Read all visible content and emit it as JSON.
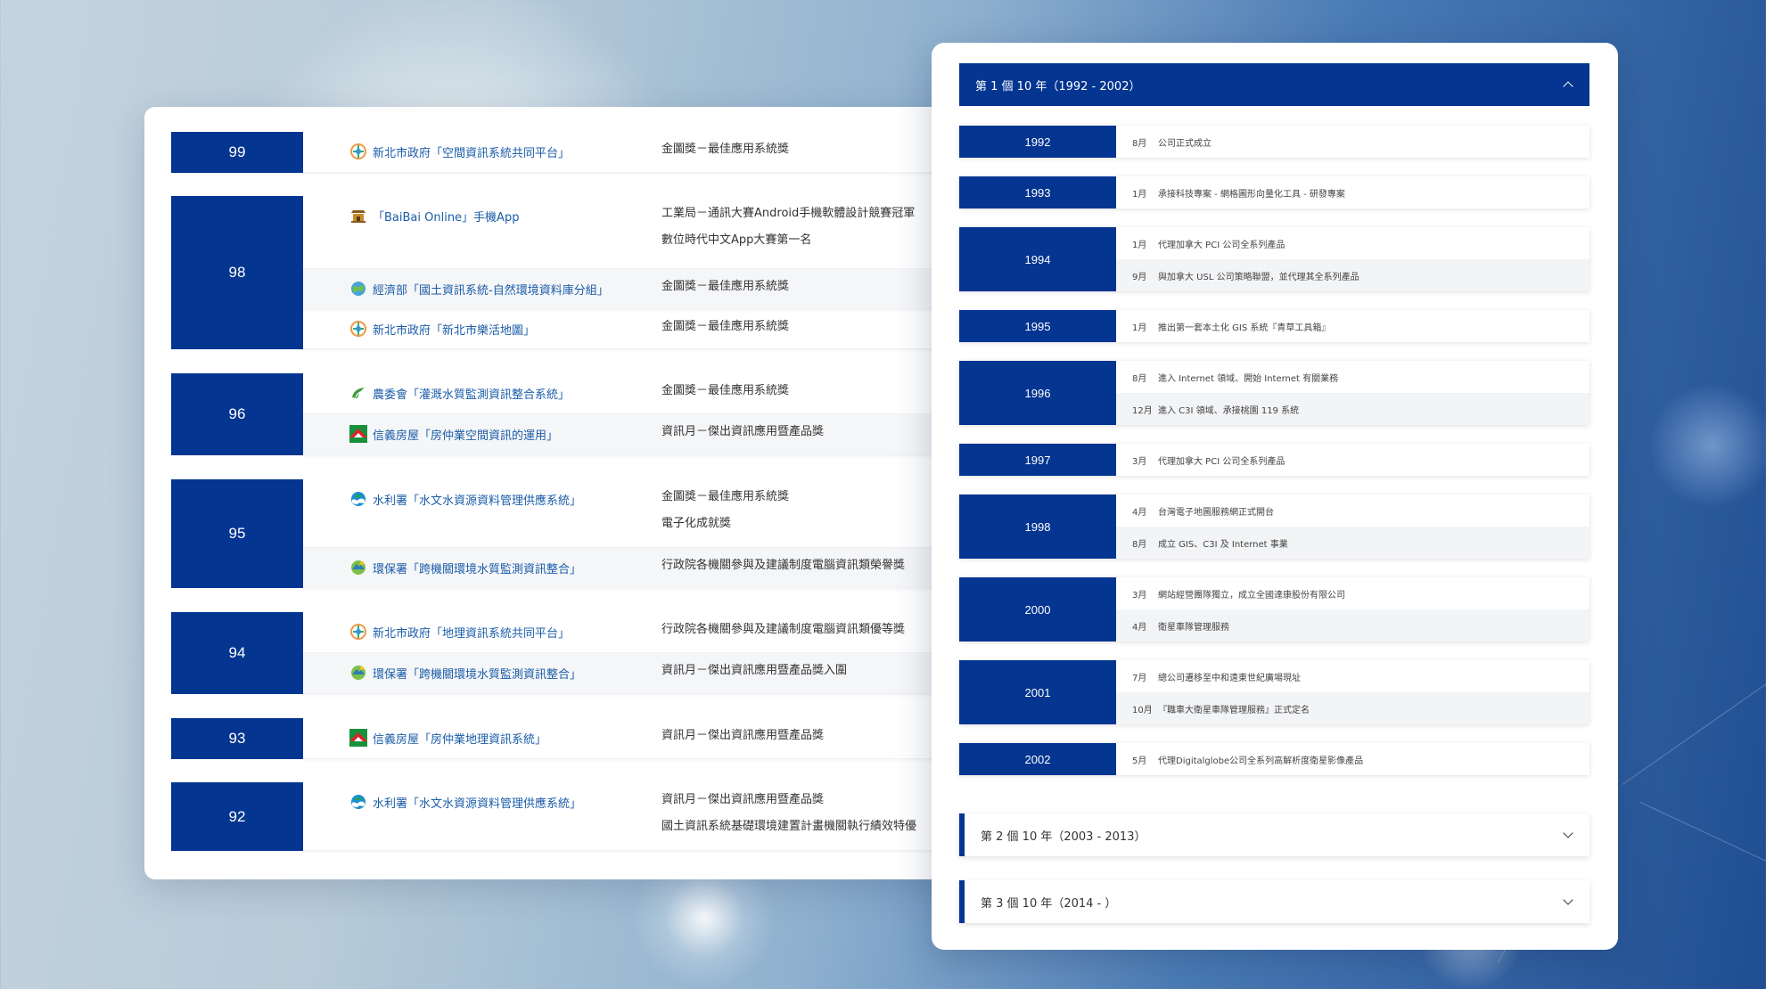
{
  "awards": [
    {
      "year": "99",
      "rows": [
        {
          "icon": "new-taipei-logo-icon",
          "project": "新北市政府「空間資訊系統共同平台」",
          "prizes": [
            "金圖獎－最佳應用系統獎"
          ]
        }
      ]
    },
    {
      "year": "98",
      "rows": [
        {
          "icon": "temple-logo-icon",
          "project": "「BaiBai Online」手機App",
          "prizes": [
            "工業局－通訊大賽Android手機軟體設計競賽冠軍",
            "數位時代中文App大賽第一名"
          ]
        },
        {
          "icon": "globe-logo-icon",
          "project": "經濟部「國土資訊系統-自然環境資料庫分組」",
          "prizes": [
            "金圖獎－最佳應用系統獎"
          ]
        },
        {
          "icon": "new-taipei-logo-icon",
          "project": "新北市政府「新北市樂活地圖」",
          "prizes": [
            "金圖獎－最佳應用系統獎"
          ]
        }
      ]
    },
    {
      "year": "96",
      "rows": [
        {
          "icon": "coa-logo-icon",
          "project": "農委會「灌溉水質監測資訊整合系統」",
          "prizes": [
            "金圖獎－最佳應用系統獎"
          ]
        },
        {
          "icon": "sinyi-logo-icon",
          "project": "信義房屋「房仲業空間資訊的運用」",
          "prizes": [
            "資訊月－傑出資訊應用暨產品獎"
          ]
        }
      ]
    },
    {
      "year": "95",
      "rows": [
        {
          "icon": "water-resources-logo-icon",
          "project": "水利署「水文水資源資料管理供應系統」",
          "prizes": [
            "金圖獎－最佳應用系統獎",
            "電子化成就獎"
          ]
        },
        {
          "icon": "epa-logo-icon",
          "project": "環保署「跨機關環境水質監測資訊整合」",
          "prizes": [
            "行政院各機關參與及建議制度電腦資訊類榮譽獎"
          ]
        }
      ]
    },
    {
      "year": "94",
      "rows": [
        {
          "icon": "new-taipei-logo-icon",
          "project": "新北市政府「地理資訊系統共同平台」",
          "prizes": [
            "行政院各機關參與及建議制度電腦資訊類優等獎"
          ]
        },
        {
          "icon": "epa-logo-icon",
          "project": "環保署「跨機關環境水質監測資訊整合」",
          "prizes": [
            "資訊月－傑出資訊應用暨產品獎入圍"
          ]
        }
      ]
    },
    {
      "year": "93",
      "rows": [
        {
          "icon": "sinyi-logo-icon",
          "project": "信義房屋「房仲業地理資訊系統」",
          "prizes": [
            "資訊月－傑出資訊應用暨產品獎"
          ]
        }
      ]
    },
    {
      "year": "92",
      "rows": [
        {
          "icon": "water-resources-logo-icon",
          "project": "水利署「水文水資源資料管理供應系統」",
          "prizes": [
            "資訊月－傑出資訊應用暨產品獎",
            "國土資訊系統基礎環境建置計畫機關執行績效特優"
          ]
        }
      ]
    }
  ],
  "timeline": {
    "decades": [
      {
        "title": "第 1 個 10 年（1992 - 2002）",
        "open": true
      },
      {
        "title": "第 2 個 10 年（2003 - 2013）",
        "open": false
      },
      {
        "title": "第 3 個 10 年（2014 - ）",
        "open": false
      }
    ],
    "years": [
      {
        "year": "1992",
        "events": [
          {
            "month": "8月",
            "text": "公司正式成立"
          }
        ]
      },
      {
        "year": "1993",
        "events": [
          {
            "month": "1月",
            "text": "承接科技專案 - 網格圖形向量化工具 - 研發專案"
          }
        ]
      },
      {
        "year": "1994",
        "events": [
          {
            "month": "1月",
            "text": "代理加拿大 PCI 公司全系列產品"
          },
          {
            "month": "9月",
            "text": "與加拿大 USL 公司策略聯盟，並代理其全系列產品"
          }
        ]
      },
      {
        "year": "1995",
        "events": [
          {
            "month": "1月",
            "text": "推出第一套本土化 GIS 系統『青草工具箱』"
          }
        ]
      },
      {
        "year": "1996",
        "events": [
          {
            "month": "8月",
            "text": "進入 Internet 領域、開始 Internet 有關業務"
          },
          {
            "month": "12月",
            "text": "進入 C3I 領域、承接桃園 119 系統"
          }
        ]
      },
      {
        "year": "1997",
        "events": [
          {
            "month": "3月",
            "text": "代理加拿大 PCI 公司全系列產品"
          }
        ]
      },
      {
        "year": "1998",
        "events": [
          {
            "month": "4月",
            "text": "台灣電子地圖服務網正式開台"
          },
          {
            "month": "8月",
            "text": "成立 GIS、C3I 及 Internet 事業"
          }
        ]
      },
      {
        "year": "2000",
        "events": [
          {
            "month": "3月",
            "text": "網站經營團隊獨立，成立全國達康股份有限公司"
          },
          {
            "month": "4月",
            "text": "衛星車隊管理服務"
          }
        ]
      },
      {
        "year": "2001",
        "events": [
          {
            "month": "7月",
            "text": "總公司遷移至中和遠東世紀廣場現址"
          },
          {
            "month": "10月",
            "text": "『職車大衛星車隊管理服務』正式定名"
          }
        ]
      },
      {
        "year": "2002",
        "events": [
          {
            "month": "5月",
            "text": "代理Digitalglobe公司全系列高解析度衛星影像產品"
          }
        ]
      }
    ]
  }
}
